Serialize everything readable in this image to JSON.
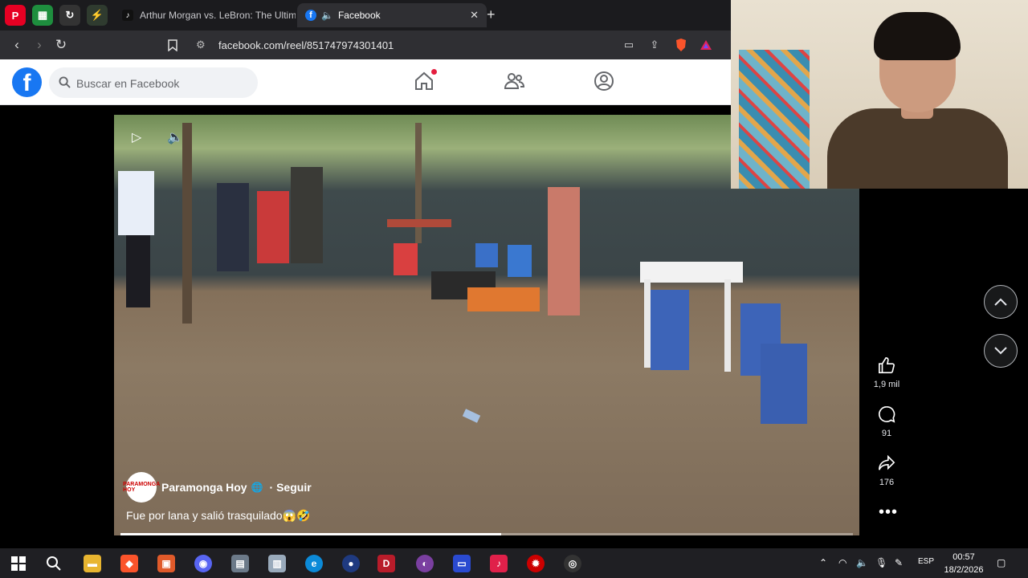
{
  "browser": {
    "tabs": [
      {
        "label": "Arthur Morgan vs. LeBron: The Ultim",
        "active": false
      },
      {
        "label": "Facebook",
        "active": true
      }
    ],
    "url": "facebook.com/reel/851747974301401"
  },
  "facebook": {
    "search_placeholder": "Buscar en Facebook"
  },
  "reel": {
    "author": "Paramonga Hoy",
    "follow_label": "· Seguir",
    "caption": "Fue por lana y salió trasquilado😱🤣",
    "avatar_text": "PARAMONGA HOY",
    "progress": 0.52,
    "likes": "1,9 mil",
    "comments": "91",
    "shares": "176"
  },
  "taskbar": {
    "language": "ESP",
    "time": "00:57",
    "date": "18/2/2026"
  },
  "colors": {
    "facebook_blue": "#1877f2",
    "notification_red": "#e41e3f"
  }
}
